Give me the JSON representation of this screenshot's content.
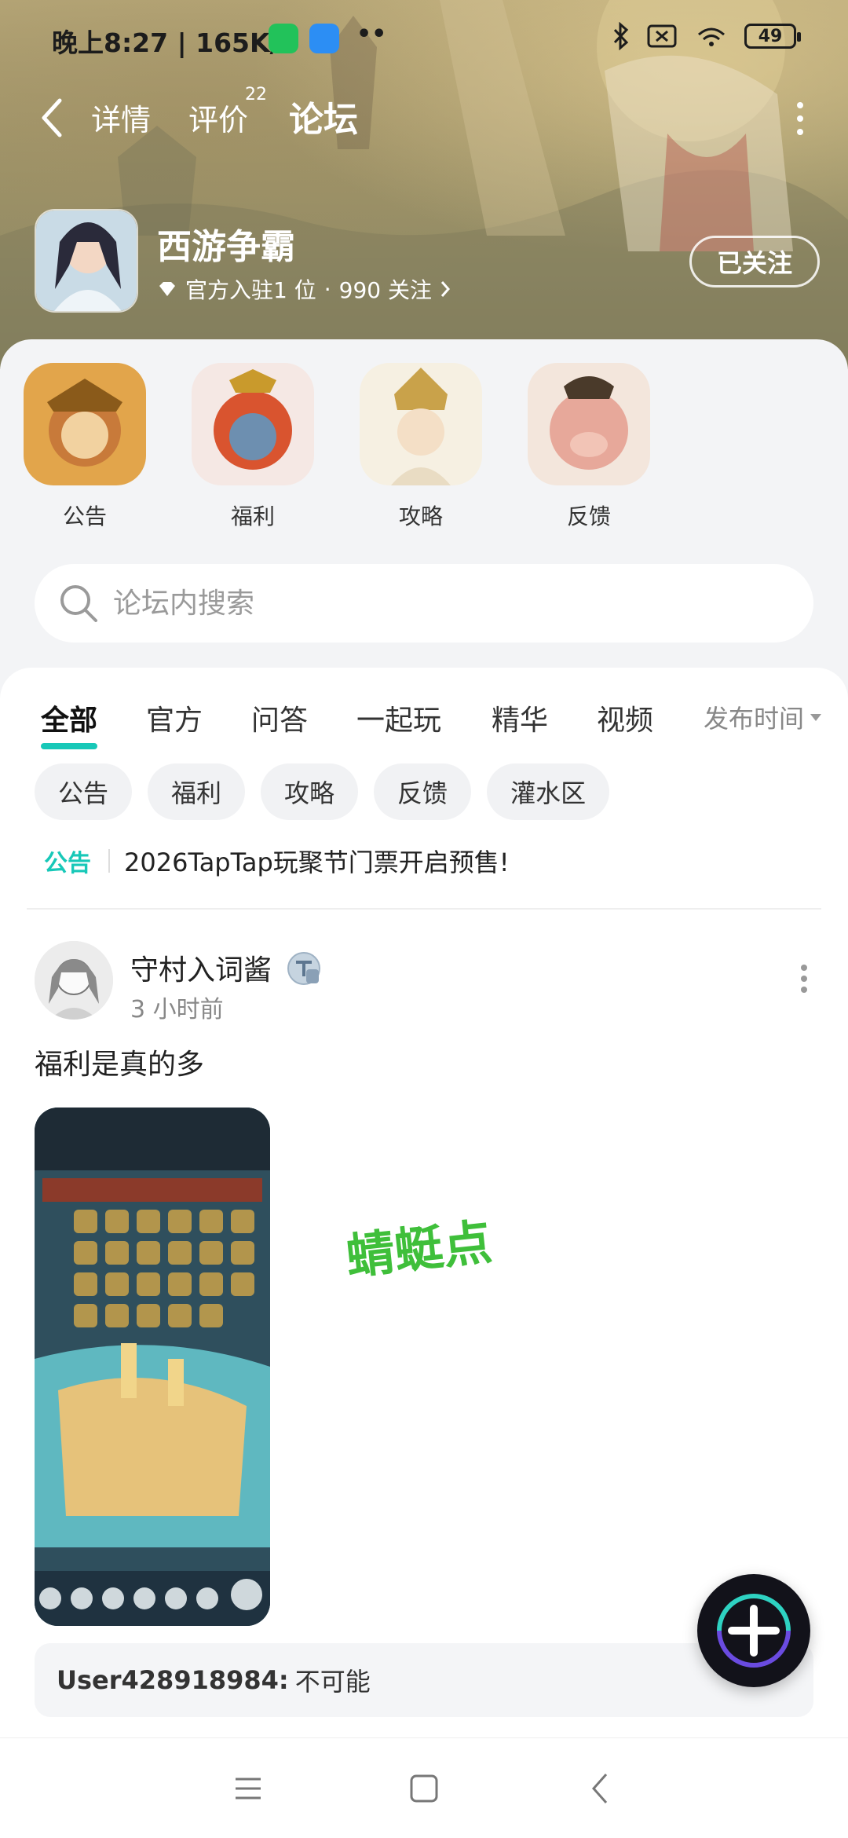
{
  "status_bar": {
    "time": "晚上8:27",
    "speed": "165K/s",
    "battery": "49"
  },
  "top_nav": {
    "tabs": [
      {
        "label": "详情"
      },
      {
        "label": "评价",
        "badge": "22"
      },
      {
        "label": "论坛"
      }
    ],
    "active_tab": "论坛"
  },
  "game": {
    "name": "西游争霸",
    "meta_official": "官方入驻1 位",
    "meta_sep": "·",
    "meta_followers": "990 关注",
    "follow_label": "已关注"
  },
  "categories": [
    {
      "label": "公告"
    },
    {
      "label": "福利"
    },
    {
      "label": "攻略"
    },
    {
      "label": "反馈"
    }
  ],
  "search": {
    "placeholder": "论坛内搜索"
  },
  "feed_tabs": [
    {
      "label": "全部"
    },
    {
      "label": "官方"
    },
    {
      "label": "问答"
    },
    {
      "label": "一起玩"
    },
    {
      "label": "精华"
    },
    {
      "label": "视频"
    }
  ],
  "sort_label": "发布时间",
  "chips": [
    {
      "label": "公告"
    },
    {
      "label": "福利"
    },
    {
      "label": "攻略"
    },
    {
      "label": "反馈"
    },
    {
      "label": "灌水区"
    }
  ],
  "notice": {
    "tag": "公告",
    "text": "2026TapTap玩聚节门票开启预售!"
  },
  "watermark": "蜻蜓点",
  "post": {
    "author": "守村入词酱",
    "time": "3 小时前",
    "text": "福利是真的多",
    "comment_user": "User428918984:",
    "comment_text": "不可能"
  },
  "colors": {
    "accent": "#17c8b8"
  }
}
